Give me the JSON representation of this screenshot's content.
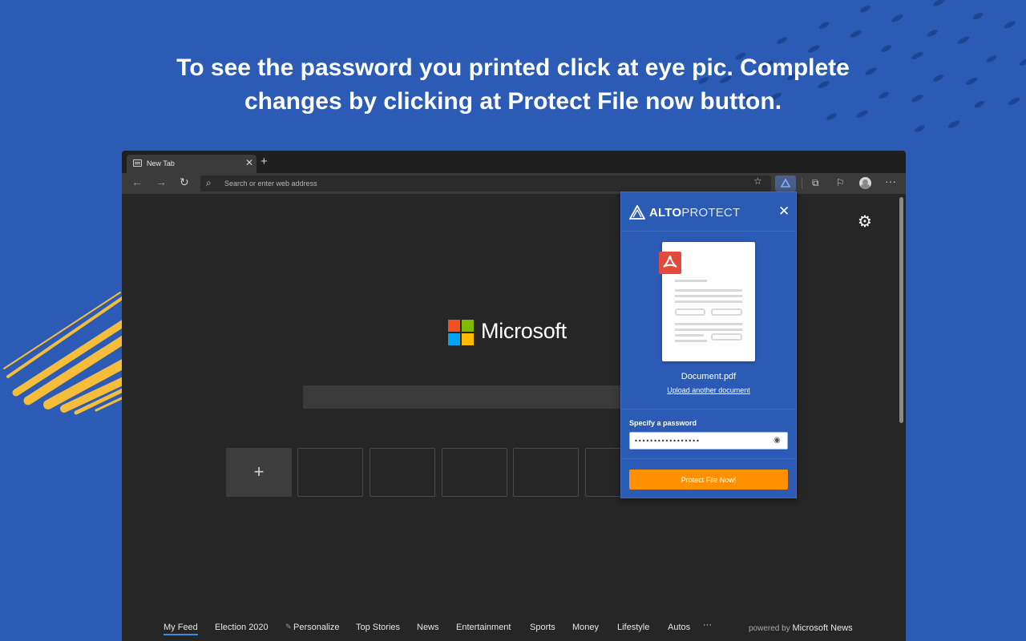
{
  "headline": {
    "line1": "To see the password you printed click at eye pic. Complete",
    "line2": "changes by clicking at Protect File now button."
  },
  "browser": {
    "tab_title": "New Tab",
    "tab_close_icon": "close-icon",
    "new_tab_icon": "plus-icon",
    "address_placeholder": "Search or enter web address",
    "toolbar_icons": [
      "back-icon",
      "forward-icon",
      "refresh-icon",
      "star-icon",
      "alto-extension-icon",
      "collections-icon",
      "read-aloud-icon",
      "profile-avatar",
      "more-icon"
    ]
  },
  "page": {
    "brand": "Microsoft",
    "logo_colors": [
      "#f25022",
      "#7fba00",
      "#00a4ef",
      "#ffb900"
    ],
    "add_tile_label": "+",
    "feed": [
      "My Feed",
      "Election 2020",
      "Personalize",
      "Top Stories",
      "News",
      "Entertainment",
      "Sports",
      "Money",
      "Lifestyle",
      "Autos",
      "···"
    ],
    "powered_prefix": "powered by",
    "powered_brand": "Microsoft News"
  },
  "popup": {
    "brand_bold": "ALTO",
    "brand_light": "PROTECT",
    "document_name": "Document.pdf",
    "upload_link": "Upload another document",
    "password_label": "Specify a password",
    "password_value": "•••••••••••••••••",
    "protect_button": "Protect File Now!",
    "colors": {
      "panel": "#2b5bb5",
      "button": "#ff9000",
      "pdf_badge": "#e24a3b"
    }
  }
}
